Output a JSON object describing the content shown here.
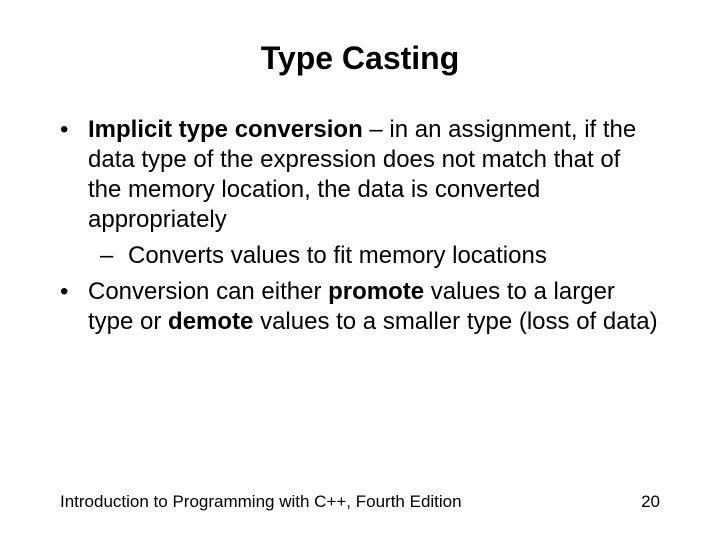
{
  "title": "Type Casting",
  "bullets": {
    "b1_term": "Implicit type conversion",
    "b1_rest": " – in an assignment, if the data type of the expression does not match that of the memory location, the data is converted appropriately",
    "b1_sub": "Converts values to fit memory locations",
    "b2_pre": "Conversion can either ",
    "b2_promote": "promote",
    "b2_mid": " values to a larger type or ",
    "b2_demote": "demote",
    "b2_post": " values to a smaller type (loss of data)"
  },
  "footer": {
    "left": "Introduction to Programming with C++, Fourth Edition",
    "right": "20"
  }
}
